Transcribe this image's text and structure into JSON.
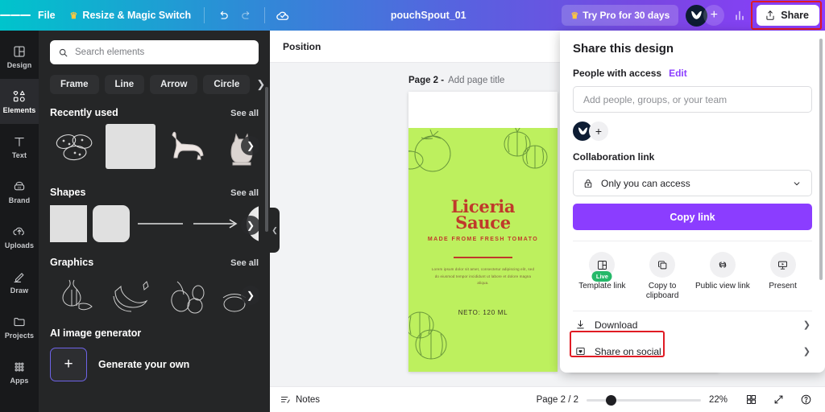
{
  "topbar": {
    "menu_icon": "hamburger-icon",
    "file_label": "File",
    "resize_label": "Resize & Magic Switch",
    "crown_icon": "crown-icon",
    "undo_icon": "undo-icon",
    "redo_icon": "redo-icon",
    "cloud_icon": "cloud-check-icon",
    "doc_title": "pouchSpout_01",
    "try_pro_label": "Try Pro for 30 days",
    "plus_icon": "plus-icon",
    "stats_icon": "bar-chart-icon",
    "share_label": "Share",
    "share_icon": "upload-icon"
  },
  "rail": {
    "items": [
      {
        "label": "Design",
        "icon": "design-icon"
      },
      {
        "label": "Elements",
        "icon": "elements-icon"
      },
      {
        "label": "Text",
        "icon": "text-icon"
      },
      {
        "label": "Brand",
        "icon": "brand-icon"
      },
      {
        "label": "Uploads",
        "icon": "uploads-icon"
      },
      {
        "label": "Draw",
        "icon": "draw-icon"
      },
      {
        "label": "Projects",
        "icon": "projects-icon"
      },
      {
        "label": "Apps",
        "icon": "apps-icon"
      }
    ],
    "active": "Elements"
  },
  "panel": {
    "search": {
      "placeholder": "Search elements",
      "value": "",
      "icon": "search-icon"
    },
    "chips": [
      "Frame",
      "Line",
      "Arrow",
      "Circle"
    ],
    "chip_more_icon": "chevron-right-icon",
    "sections": [
      {
        "title": "Recently used",
        "see_all": "See all"
      },
      {
        "title": "Shapes",
        "see_all": "See all"
      },
      {
        "title": "Graphics",
        "see_all": "See all"
      }
    ],
    "ai": {
      "title": "AI image generator",
      "card_label": "Generate your own",
      "plus_icon": "plus-icon"
    },
    "collapse_icon": "chevron-left-icon"
  },
  "canvas": {
    "position_label": "Position",
    "page_number_label": "Page 2 -",
    "page_title_placeholder": "Add page title",
    "collapse_icon": "chevron-up-icon",
    "design": {
      "title_line1": "Liceria",
      "title_line2": "Sauce",
      "subtitle": "MADE FROME FRESH TOMATO",
      "body": "Lorem ipsum dolor sit amet, consectetur adipiscing elit, sed do eiusmod tempor incididunt ut labore et dolore magna aliqua.",
      "neto": "NETO: 120 ML",
      "bg_color": "#bdf05e",
      "accent_color": "#c0392b"
    }
  },
  "bottombar": {
    "notes_label": "Notes",
    "notes_icon": "notes-icon",
    "page_count": "Page 2 / 2",
    "zoom_value": "22%",
    "grid_icon": "grid-icon",
    "expand_icon": "expand-icon",
    "help_icon": "help-icon"
  },
  "share_panel": {
    "title": "Share this design",
    "people_label": "People with access",
    "edit_label": "Edit",
    "people_placeholder": "Add people, groups, or your team",
    "people_value": "",
    "avatar_icon": "avatar-icon",
    "add_person_icon": "plus-icon",
    "collab_label": "Collaboration link",
    "access_value": "Only you can access",
    "lock_icon": "lock-icon",
    "chevron_icon": "chevron-down-icon",
    "copy_link_label": "Copy link",
    "actions": [
      {
        "label": "Template link",
        "icon": "template-icon",
        "badge": "Live"
      },
      {
        "label": "Copy to clipboard",
        "icon": "copy-icon",
        "badge": ""
      },
      {
        "label": "Public view link",
        "icon": "link-icon",
        "badge": ""
      },
      {
        "label": "Present",
        "icon": "present-icon",
        "badge": ""
      }
    ],
    "list": [
      {
        "label": "Download",
        "icon": "download-icon",
        "chevron": "chevron-right-icon"
      },
      {
        "label": "Share on social",
        "icon": "social-icon",
        "chevron": "chevron-right-icon"
      }
    ]
  },
  "annotations": {
    "highlight_color": "#e01b24",
    "boxes": [
      "share-button",
      "download-row"
    ]
  }
}
